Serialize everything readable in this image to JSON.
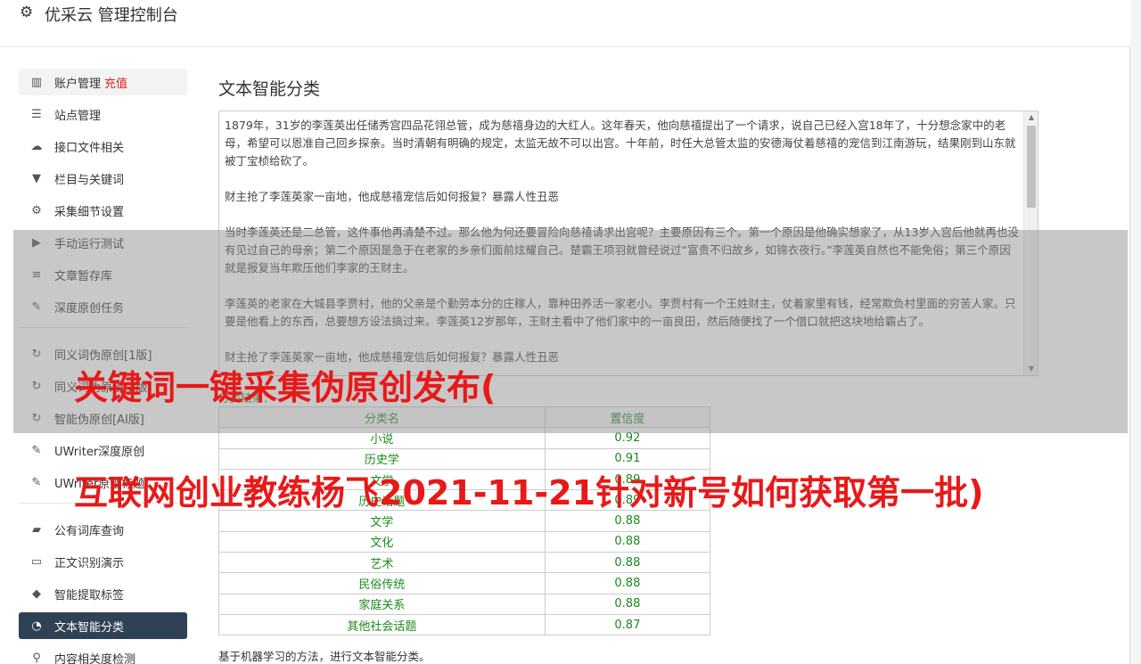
{
  "header": {
    "title": "优采云 管理控制台"
  },
  "sidebar": {
    "groups": [
      [
        {
          "label": "账户管理",
          "badge": "充值",
          "icon": "bar-chart-icon"
        },
        {
          "label": "站点管理",
          "icon": "server-icon"
        },
        {
          "label": "接口文件相关",
          "icon": "cloud-upload-icon"
        },
        {
          "label": "栏目与关键词",
          "icon": "filter-icon"
        },
        {
          "label": "采集细节设置",
          "icon": "gears-icon"
        },
        {
          "label": "手动运行测试",
          "icon": "play-icon"
        },
        {
          "label": "文章暂存库",
          "icon": "database-icon"
        },
        {
          "label": "深度原创任务",
          "icon": "edit-icon"
        }
      ],
      [
        {
          "label": "同义词伪原创[1版]",
          "icon": "refresh-icon"
        },
        {
          "label": "同义词伪原创[2版]",
          "icon": "refresh-icon"
        },
        {
          "label": "智能伪原创[AI版]",
          "icon": "refresh-icon"
        },
        {
          "label": "UWriter深度原创",
          "icon": "edit-icon"
        },
        {
          "label": "UWriter原创标题",
          "icon": "edit-icon"
        }
      ],
      [
        {
          "label": "公有词库查询",
          "icon": "book-icon"
        },
        {
          "label": "正文识别演示",
          "icon": "monitor-icon"
        },
        {
          "label": "智能提取标签",
          "icon": "tag-icon"
        },
        {
          "label": "文本智能分类",
          "icon": "pie-chart-icon"
        },
        {
          "label": "内容相关度检测",
          "icon": "link-icon"
        }
      ]
    ]
  },
  "main": {
    "title": "文本智能分类",
    "text_paragraphs": [
      "1879年，31岁的李莲英出任储秀宫四品花翎总管，成为慈禧身边的大红人。这年春天，他向慈禧提出了一个请求，说自己已经入宫18年了，十分想念家中的老母，希望可以恩准自己回乡探亲。当时清朝有明确的规定，太监无故不可以出宫。十年前，时任大总管太监的安德海仗着慈禧的宠信到江南游玩，结果刚到山东就被丁宝桢给砍了。",
      "财主抢了李莲英家一亩地，他成慈禧宠信后如何报复？暴露人性丑恶",
      "当时李莲英还是二总管，这件事他再清楚不过。那么他为何还要冒险向慈禧请求出宫呢？主要原因有三个。第一个原因是他确实想家了，从13岁入宫后他就再也没有见过自己的母亲；第二个原因是急于在老家的乡亲们面前炫耀自己。楚霸王项羽就曾经说过“富贵不归故乡，如锦衣夜行。”李莲英自然也不能免俗；第三个原因就是报复当年欺压他们李家的王财主。",
      "李莲英的老家在大城县李贾村，他的父亲是个勤劳本分的庄稼人，靠种田养活一家老小。李贾村有一个王姓财主，仗着家里有钱，经常欺负村里面的穷苦人家。只要是他看上的东西，总要想方设法搞过来。李莲英12岁那年，王财主看中了他们家中的一亩良田，然后随便找了一个借口就把这块地给霸占了。",
      "财主抢了李莲英家一亩地，他成慈禧宠信后如何报复？暴露人性丑恶"
    ],
    "result_label": "分类结果：",
    "table": {
      "headers": [
        "分类名",
        "置信度"
      ],
      "rows": [
        [
          "小说",
          "0.92"
        ],
        [
          "历史学",
          "0.91"
        ],
        [
          "文学",
          "0.89"
        ],
        [
          "历史话题",
          "0.89"
        ],
        [
          "文学",
          "0.88"
        ],
        [
          "文化",
          "0.88"
        ],
        [
          "艺术",
          "0.88"
        ],
        [
          "民俗传统",
          "0.88"
        ],
        [
          "家庭关系",
          "0.88"
        ],
        [
          "其他社会话题",
          "0.87"
        ]
      ]
    },
    "footnote": "基于机器学习的方法，进行文本智能分类。"
  },
  "overlay": {
    "line1": "关键词一键采集伪原创发布(",
    "line2": "互联网创业教练杨飞2021-11-21针对新号如何获取第一批)"
  }
}
